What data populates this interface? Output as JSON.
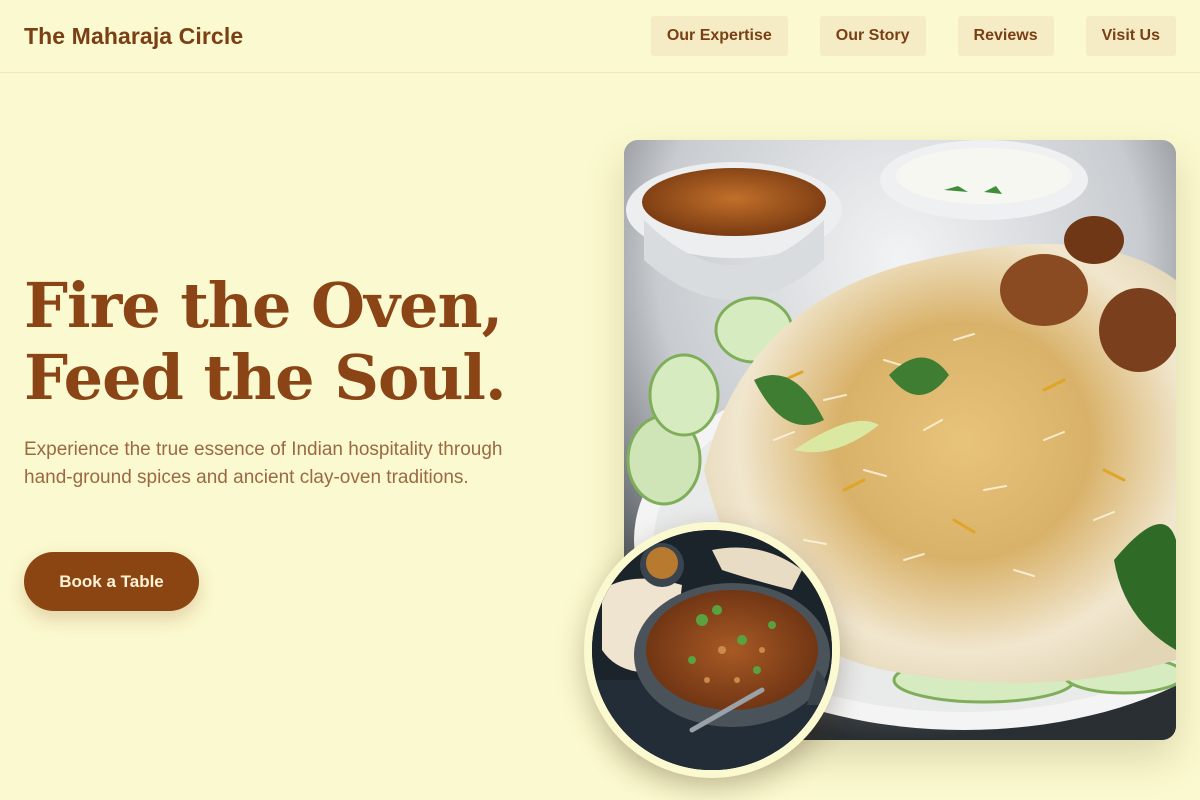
{
  "header": {
    "brand": "The Maharaja Circle",
    "nav": [
      "Our Expertise",
      "Our Story",
      "Reviews",
      "Visit Us"
    ]
  },
  "hero": {
    "title_line1": "Fire the Oven,",
    "title_line2": "Feed the Soul.",
    "subtitle": "Experience the true essence of Indian hospitality through hand-ground spices and ancient clay-oven traditions.",
    "cta_label": "Book a Table"
  },
  "images": {
    "main": "biryani-plate-photo",
    "inset": "curry-pan-photo"
  },
  "colors": {
    "background": "#fbf9cf",
    "brand_brown": "#8b4513",
    "nav_bg": "#f5ecc6",
    "subtitle": "#9a6a45"
  }
}
